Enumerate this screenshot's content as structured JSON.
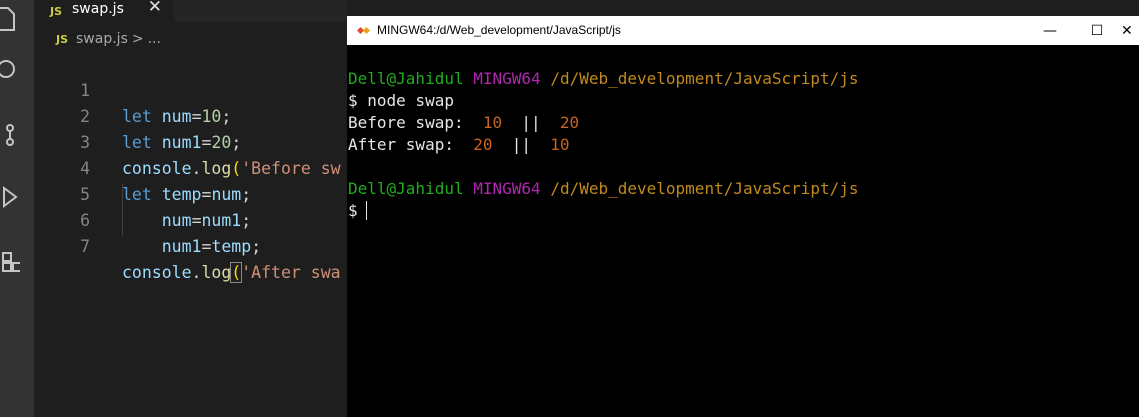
{
  "editor": {
    "tab": {
      "badge": "JS",
      "filename": "swap.js",
      "close": "✕"
    },
    "breadcrumb": {
      "badge": "JS",
      "filename": "swap.js",
      "separator": ">",
      "more": "..."
    },
    "lines": [
      {
        "number": "1",
        "text": "let num=10;"
      },
      {
        "number": "2",
        "text": "let num1=20;"
      },
      {
        "number": "3",
        "text": "console.log('Before sw"
      },
      {
        "number": "4",
        "text": "let temp=num;"
      },
      {
        "number": "5",
        "text": "num=num1;"
      },
      {
        "number": "6",
        "text": "num1=temp;"
      },
      {
        "number": "7",
        "text": "console.log('After swa"
      }
    ],
    "activity_icons": [
      "files-icon",
      "search-icon",
      "source-control-icon",
      "run-debug-icon",
      "extensions-icon"
    ]
  },
  "terminal": {
    "title": "MINGW64:/d/Web_development/JavaScript/js",
    "controls": {
      "minimize": "—",
      "maximize": "☐",
      "close": "✕"
    },
    "prompt1": {
      "user": "Dell@Jahidul",
      "env": "MINGW64",
      "path": "/d/Web_development/JavaScript/js"
    },
    "command": "$ node swap",
    "output": [
      {
        "label": "Before swap:",
        "a": "10",
        "sep": "||",
        "b": "20"
      },
      {
        "label": "After swap:",
        "a": "20",
        "sep": "||",
        "b": "10"
      }
    ],
    "prompt2": {
      "user": "Dell@Jahidul",
      "env": "MINGW64",
      "path": "/d/Web_development/JavaScript/js"
    },
    "prompt_symbol": "$"
  },
  "colors": {
    "editor_bg": "#1e1e1e",
    "activitybar_bg": "#333333",
    "terminal_bg": "#000000",
    "user_green": "#1fad1f",
    "mingw_magenta": "#b126b1",
    "path_orange": "#c08a1c"
  }
}
